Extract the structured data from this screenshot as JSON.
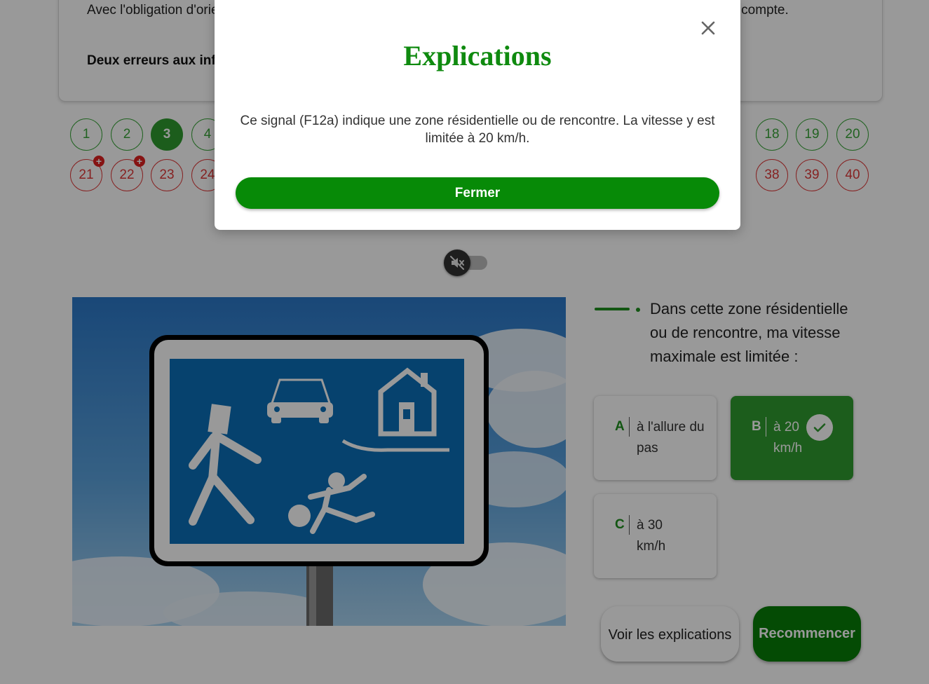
{
  "intro": {
    "text": "Avec l'obligation d'orienter vos réponses sur les questions concernant des infractions légères, chaque réponse compte.",
    "bold": "Deux erreurs aux infractions graves entraînent l'échec."
  },
  "question_numbers": {
    "row1": [
      {
        "n": "1",
        "state": "ok"
      },
      {
        "n": "2",
        "state": "ok"
      },
      {
        "n": "3",
        "state": "current"
      },
      {
        "n": "4",
        "state": "ok"
      },
      {
        "n": "18",
        "state": "ok"
      },
      {
        "n": "19",
        "state": "ok"
      },
      {
        "n": "20",
        "state": "ok"
      }
    ],
    "row2": [
      {
        "n": "21",
        "state": "bad",
        "plus": "+"
      },
      {
        "n": "22",
        "state": "bad",
        "plus": "+"
      },
      {
        "n": "23",
        "state": "bad"
      },
      {
        "n": "24",
        "state": "bad"
      },
      {
        "n": "38",
        "state": "bad"
      },
      {
        "n": "39",
        "state": "bad"
      },
      {
        "n": "40",
        "state": "bad"
      }
    ]
  },
  "sound_toggle": {
    "icon": "speaker-muted-icon",
    "state": "off"
  },
  "question": {
    "text": "Dans cette zone résidentielle ou de rencontre, ma vitesse maximale est limitée :"
  },
  "answers": [
    {
      "letter": "A",
      "text": "à l'allure du pas",
      "selected": false
    },
    {
      "letter": "B",
      "text": "à 20 km/h",
      "selected": true
    },
    {
      "letter": "C",
      "text": "à 30 km/h",
      "selected": false
    }
  ],
  "buttons": {
    "explanations": "Voir les explications",
    "restart": "Recommencer"
  },
  "modal": {
    "title": "Explications",
    "body": "Ce signal (F12a) indique une zone résidentielle ou de rencontre. La vitesse y est limitée à 20 km/h.",
    "close_button": "Fermer",
    "close_icon": "close-icon"
  },
  "colors": {
    "accent_green": "#0f8a0f",
    "correct_green": "#2f9c2f",
    "error_red": "#e03a3a",
    "sign_blue": "#0a6eb7"
  }
}
